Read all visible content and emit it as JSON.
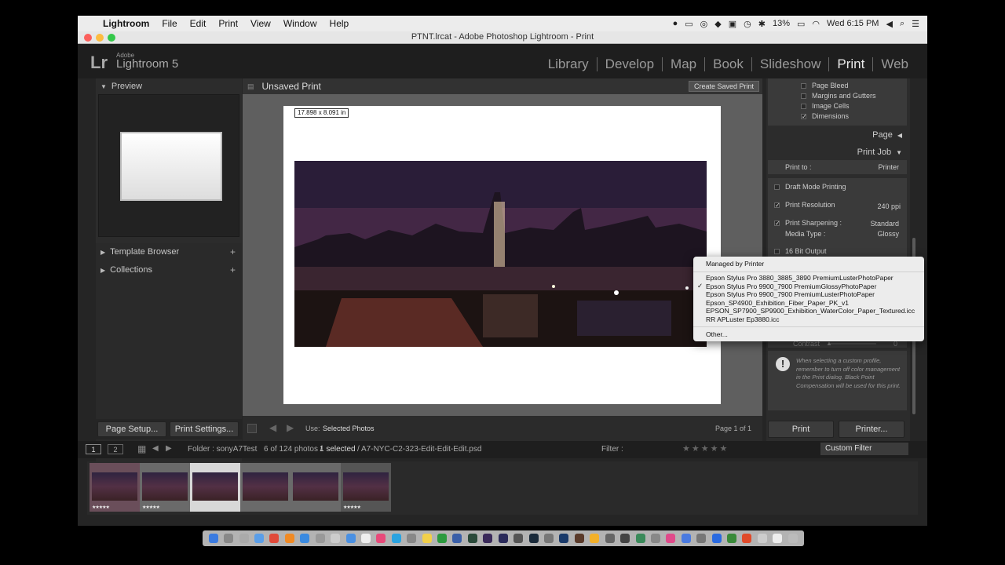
{
  "menubar": {
    "app": "Lightroom",
    "items": [
      "File",
      "Edit",
      "Print",
      "View",
      "Window",
      "Help"
    ],
    "battery": "13%",
    "clock": "Wed 6:15 PM"
  },
  "window": {
    "title": "PTNT.lrcat - Adobe Photoshop Lightroom - Print"
  },
  "logo": {
    "lr": "Lr",
    "brand": "Adobe",
    "product": "Lightroom 5"
  },
  "modules": [
    "Library",
    "Develop",
    "Map",
    "Book",
    "Slideshow",
    "Print",
    "Web"
  ],
  "active_module": "Print",
  "left_panel": {
    "preview": "Preview",
    "template_browser": "Template Browser",
    "collections": "Collections",
    "page_setup": "Page Setup...",
    "print_settings": "Print Settings..."
  },
  "center": {
    "title": "Unsaved Print",
    "create_saved": "Create Saved Print",
    "dims": "17.898 x 8.091 in",
    "use_label": "Use:",
    "use_value": "Selected Photos",
    "page_count": "Page 1 of 1"
  },
  "right_panel": {
    "guides": [
      {
        "label": "Page Bleed",
        "checked": false
      },
      {
        "label": "Margins and Gutters",
        "checked": false
      },
      {
        "label": "Image Cells",
        "checked": false
      },
      {
        "label": "Dimensions",
        "checked": true
      }
    ],
    "page": "Page",
    "print_job": "Print Job",
    "print_to_label": "Print to :",
    "print_to_value": "Printer",
    "draft": "Draft Mode Printing",
    "resolution_label": "Print Resolution",
    "resolution_value": "240 ppi",
    "sharpening_label": "Print Sharpening :",
    "sharpening_value": "Standard",
    "media_label": "Media Type :",
    "media_value": "Glossy",
    "bit16": "16 Bit Output",
    "contrast_label": "Contrast",
    "contrast_value": "0",
    "warning": "When selecting a custom profile, remember to turn off color management in the Print dialog. Black Point Compensation will be used for this print.",
    "print_btn": "Print",
    "printer_btn": "Printer..."
  },
  "dropdown": {
    "header": "Managed by Printer",
    "items": [
      "Epson Stylus Pro 3880_3885_3890 PremiumLusterPhotoPaper",
      "Epson Stylus Pro 9900_7900 PremiumGlossyPhotoPaper",
      "Epson Stylus Pro 9900_7900 PremiumLusterPhotoPaper",
      "Epson_SP4900_Exhibition_Fiber_Paper_PK_v1",
      "EPSON_SP7900_SP9900_Exhibition_WaterColor_Paper_Textured.icc",
      "RR APLuster Ep3880.icc"
    ],
    "checked_index": 1,
    "other": "Other..."
  },
  "filmstrip": {
    "page1": "1",
    "page2": "2",
    "folder": "Folder : sonyA7Test",
    "count": "6 of 124 photos /",
    "selected": "1 selected",
    "file": "/ A7-NYC-C2-323-Edit-Edit-Edit.psd",
    "filter_label": "Filter :",
    "custom_filter": "Custom Filter",
    "thumb_stars": [
      "★★★★★",
      "★★★★★",
      "",
      "",
      "",
      "★★★★★"
    ]
  }
}
